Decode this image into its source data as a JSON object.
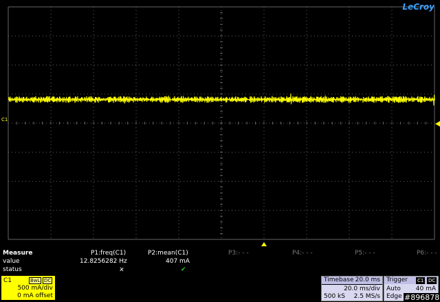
{
  "brand": "LeCroy",
  "channel_marker": "C1",
  "measure": {
    "header": "Measure",
    "row_value_label": "value",
    "row_status_label": "status",
    "params": [
      {
        "name": "P1:freq(C1)",
        "value": "12.8256282 Hz",
        "status": "ϰ"
      },
      {
        "name": "P2:mean(C1)",
        "value": "407 mA",
        "status": "✔"
      },
      {
        "name": "P3:- - -",
        "value": "",
        "status": ""
      },
      {
        "name": "P4:- - -",
        "value": "",
        "status": ""
      },
      {
        "name": "P5:- - -",
        "value": "",
        "status": ""
      },
      {
        "name": "P6:- - -",
        "value": "",
        "status": ""
      }
    ]
  },
  "channel": {
    "name": "C1",
    "bwl": "BwL",
    "coupling": "DC",
    "vdiv": "500 mA/div",
    "offset": "0 mA offset"
  },
  "timebase": {
    "label": "Timebase",
    "delay": "20.0 ms",
    "tdiv": "20.0 ms/div",
    "samples": "500 kS",
    "rate": "2.5 MS/s"
  },
  "trigger": {
    "label": "Trigger",
    "source": "C1",
    "coupling": "DC",
    "mode": "Auto",
    "level": "40 mA",
    "type": "Edge",
    "slope": "Positive"
  },
  "colors": {
    "trace": "#ffff00",
    "grid": "#666666",
    "background": "#000000",
    "accent": "#3aa0ff"
  },
  "watermark": "#896878"
}
